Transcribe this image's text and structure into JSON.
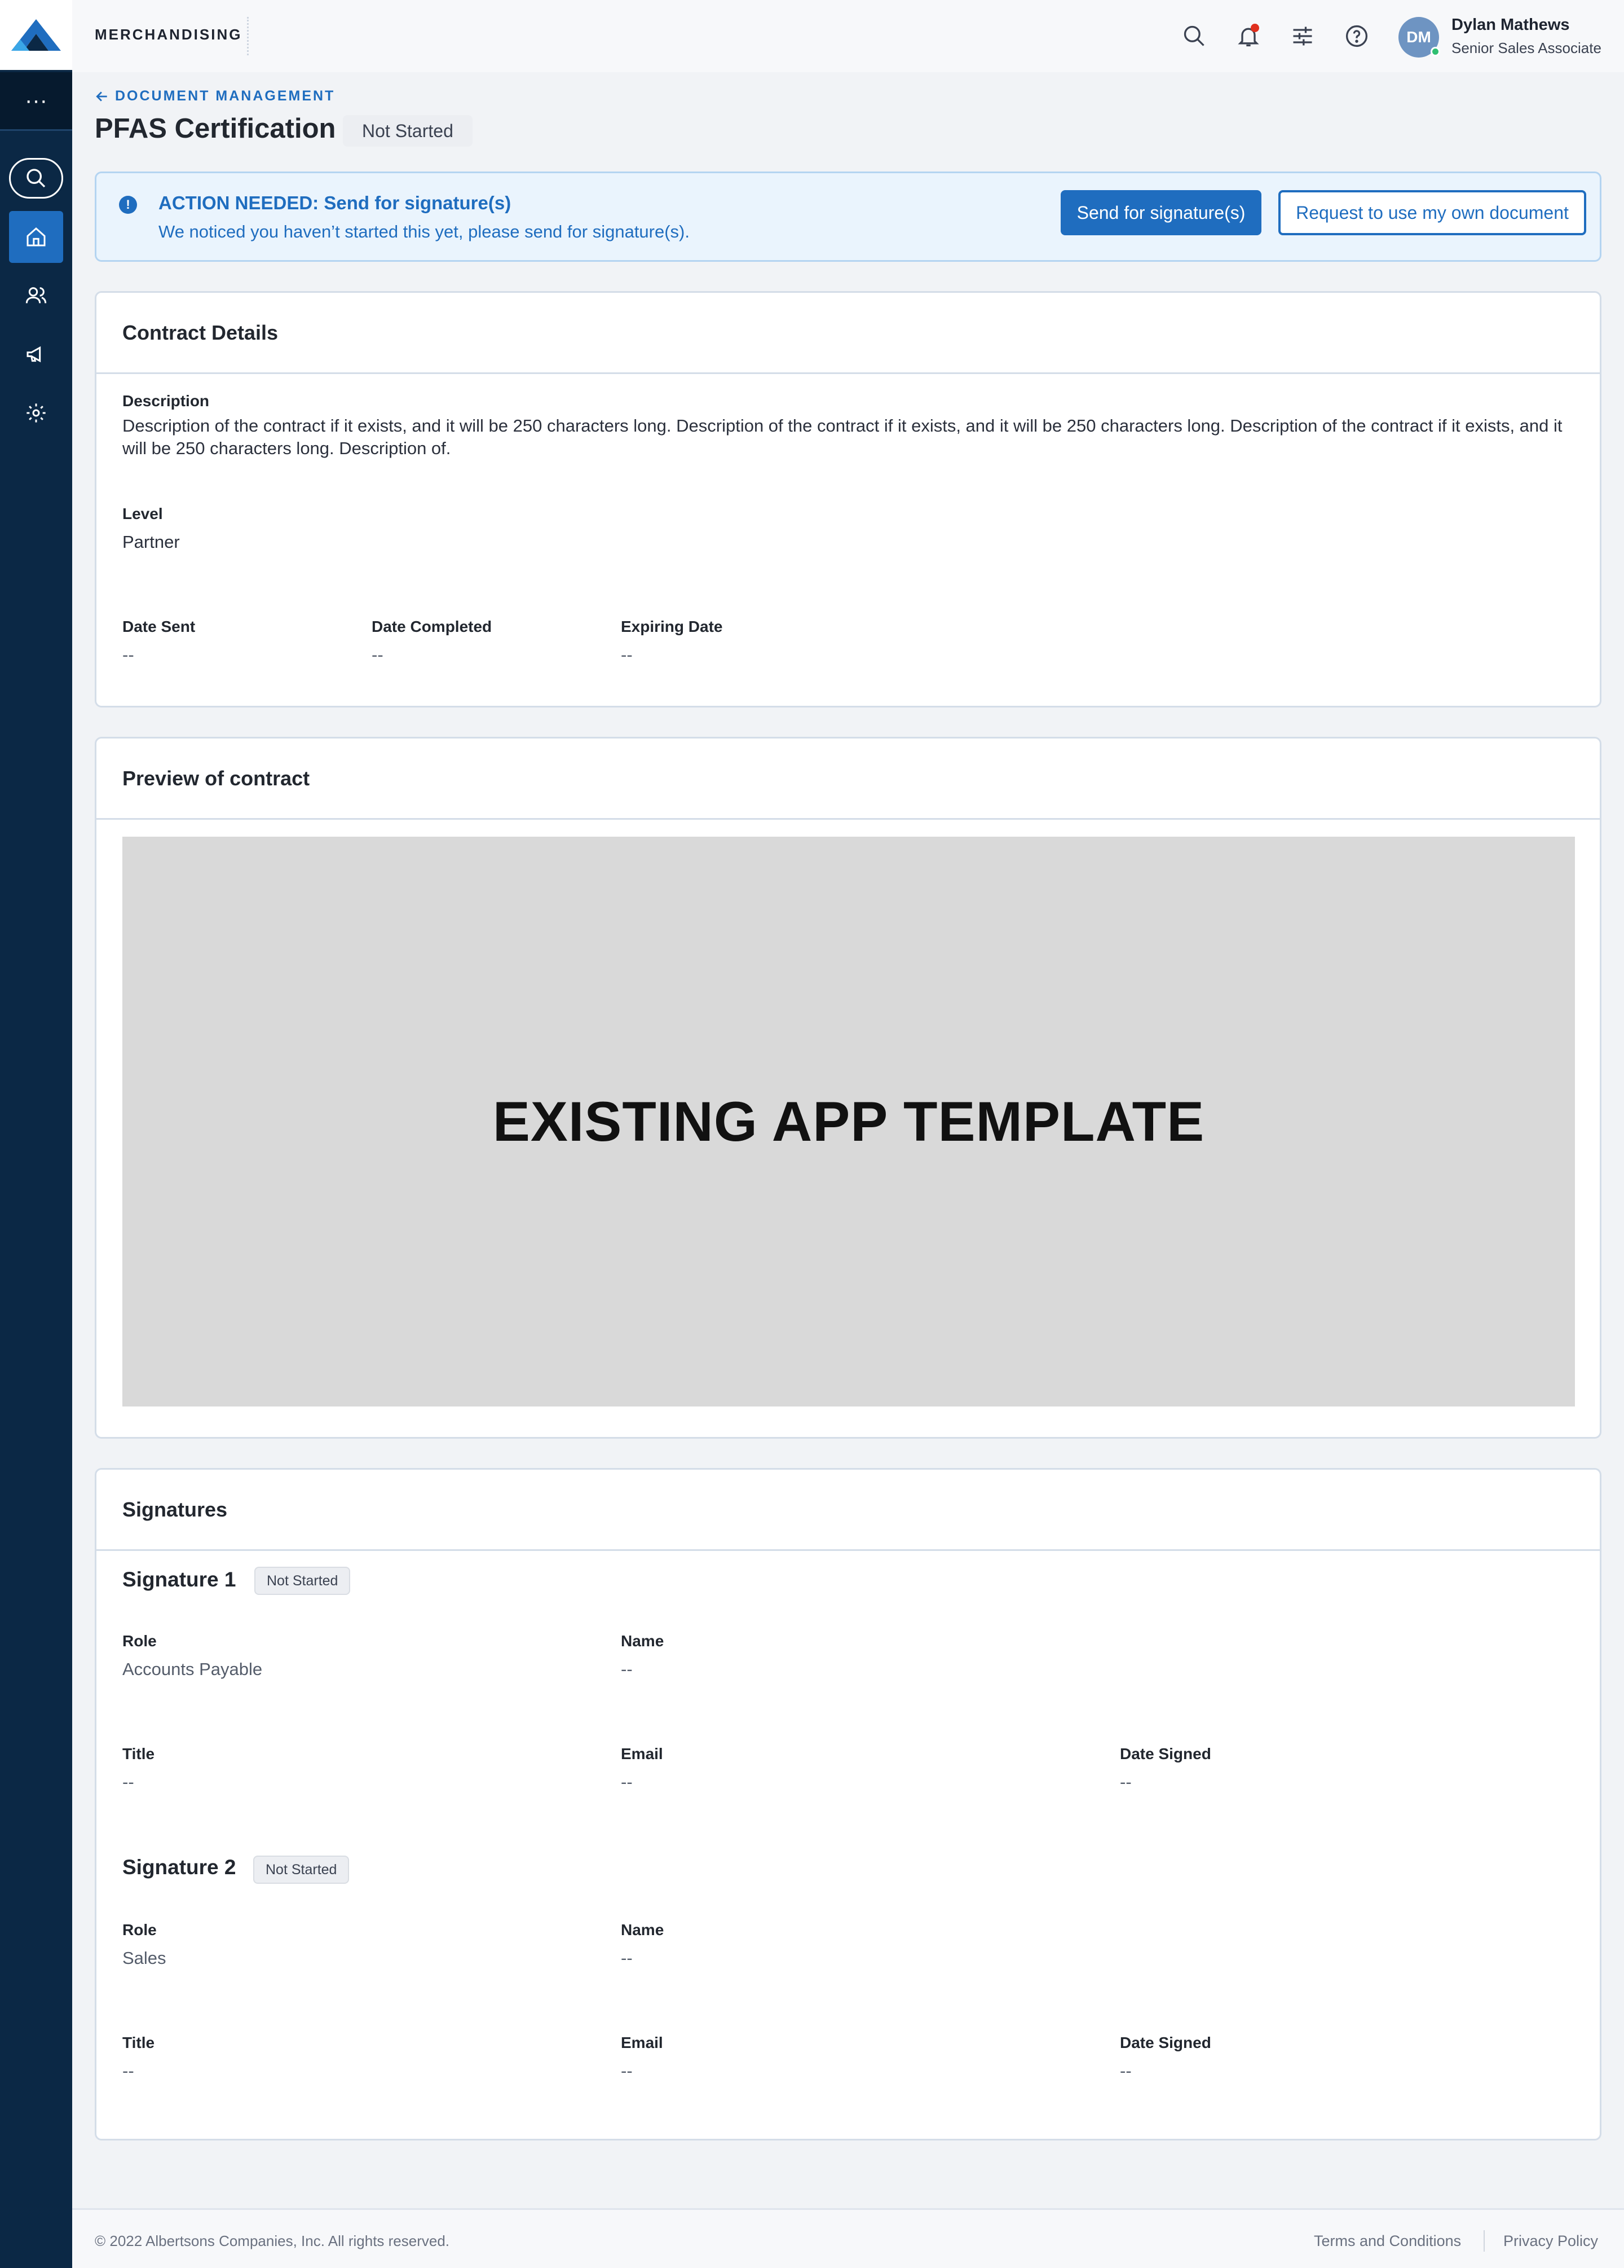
{
  "app": {
    "brand": "MERCHANDISING"
  },
  "user": {
    "initials": "DM",
    "name": "Dylan Mathews",
    "role": "Senior Sales Associate"
  },
  "nav": {
    "more": "···"
  },
  "breadcrumb": {
    "label": "DOCUMENT MANAGEMENT"
  },
  "page": {
    "title": "PFAS Certification",
    "status": "Not Started"
  },
  "alert": {
    "title": "ACTION NEEDED: Send for signature(s)",
    "text": "We noticed you haven’t started this yet, please send for signature(s).",
    "primary_label": "Send for signature(s)",
    "secondary_label": "Request to use my own document"
  },
  "contract": {
    "heading": "Contract Details",
    "description_label": "Description",
    "description": "Description of the contract if it exists, and it will be 250 characters long. Description of the contract if it exists, and it will be 250 characters long. Description of the contract if it exists, and it will be 250 characters long. Description of.",
    "level_label": "Level",
    "level": "Partner",
    "date_sent_label": "Date Sent",
    "date_sent": "--",
    "date_completed_label": "Date Completed",
    "date_completed": "--",
    "expiring_label": "Expiring Date",
    "expiring": "--"
  },
  "preview": {
    "heading": "Preview of contract",
    "placeholder": "EXISTING APP TEMPLATE"
  },
  "signatures": {
    "heading": "Signatures",
    "items": [
      {
        "title": "Signature 1",
        "status": "Not Started",
        "role_label": "Role",
        "role": "Accounts Payable",
        "name_label": "Name",
        "name": "--",
        "title_label": "Title",
        "title_value": "--",
        "email_label": "Email",
        "email": "--",
        "date_label": "Date Signed",
        "date": "--"
      },
      {
        "title": "Signature 2",
        "status": "Not Started",
        "role_label": "Role",
        "role": "Sales",
        "name_label": "Name",
        "name": "--",
        "title_label": "Title",
        "title_value": "--",
        "email_label": "Email",
        "email": "--",
        "date_label": "Date Signed",
        "date": "--"
      }
    ]
  },
  "footer": {
    "copyright": "© 2022 Albertsons Companies, Inc. All rights reserved.",
    "terms": "Terms and Conditions",
    "privacy": "Privacy Policy"
  },
  "icons": [
    "logo-icon",
    "more-icon",
    "search-icon",
    "home-icon",
    "people-icon",
    "megaphone-icon",
    "gear-icon",
    "bell-icon",
    "sliders-icon",
    "help-icon",
    "arrow-left-icon",
    "alert-icon"
  ],
  "colors": {
    "accent": "#1f6dbf",
    "sidebar": "#0b2845",
    "notification": "#e0301e",
    "online": "#2fbf71"
  }
}
